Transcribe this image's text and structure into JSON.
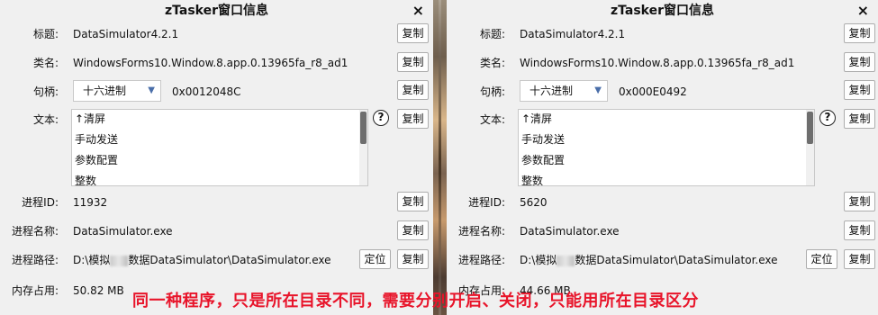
{
  "panels": [
    {
      "title": "zTasker窗口信息",
      "close_icon": "×",
      "labels": {
        "title": "标题:",
        "class": "类名:",
        "handle": "句柄:",
        "text": "文本:",
        "pid": "进程ID:",
        "pname": "进程名称:",
        "ppath": "进程路径:",
        "mem": "内存占用:"
      },
      "title_value": "DataSimulator4.2.1",
      "class_value": "WindowsForms10.Window.8.app.0.13965fa_r8_ad1",
      "handle_format": "十六进制",
      "handle_value": "0x0012048C",
      "text_items": [
        "↑清屏",
        "手动发送",
        "参数配置",
        "整数"
      ],
      "pid_value": "11932",
      "pname_value": "DataSimulator.exe",
      "ppath_prefix": "D:\\模拟",
      "ppath_suffix": "数据DataSimulator\\DataSimulator.exe",
      "mem_value": "50.82 MB",
      "copy_label": "复制",
      "locate_label": "定位",
      "help_label": "?"
    },
    {
      "title": "zTasker窗口信息",
      "close_icon": "×",
      "labels": {
        "title": "标题:",
        "class": "类名:",
        "handle": "句柄:",
        "text": "文本:",
        "pid": "进程ID:",
        "pname": "进程名称:",
        "ppath": "进程路径:",
        "mem": "内存占用:"
      },
      "title_value": "DataSimulator4.2.1",
      "class_value": "WindowsForms10.Window.8.app.0.13965fa_r8_ad1",
      "handle_format": "十六进制",
      "handle_value": "0x000E0492",
      "text_items": [
        "↑清屏",
        "手动发送",
        "参数配置",
        "整数"
      ],
      "pid_value": "5620",
      "pname_value": "DataSimulator.exe",
      "ppath_prefix": "D:\\模拟",
      "ppath_suffix": "数据DataSimulator\\DataSimulator.exe",
      "mem_value": "44.66 MB",
      "copy_label": "复制",
      "locate_label": "定位",
      "help_label": "?"
    }
  ],
  "caption": "同一种程序，只是所在目录不同，需要分别开启、关闭，只能用所在目录区分",
  "colors": {
    "caption": "#e8142a",
    "panel_bg": "#f0f0f0",
    "chevron": "#4a6ea9"
  }
}
